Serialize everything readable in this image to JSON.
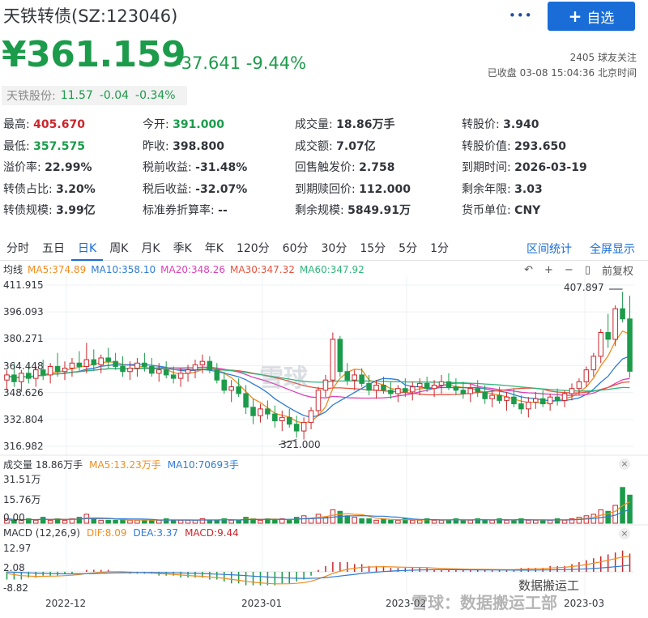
{
  "header": {
    "title": "天铁转债(SZ:123046)",
    "more": "•••",
    "add_button_plus": "+",
    "add_button": "自选",
    "price": "¥361.159",
    "change": "-37.641",
    "change_pct": "-9.44%",
    "follow": "2405 球友关注",
    "status": "已收盘 03-08 15:04:36 北京时间"
  },
  "stock_tag": {
    "label": "天铁股份:",
    "price": "11.57",
    "change": "-0.04",
    "pct": "-0.34%"
  },
  "quote": [
    [
      {
        "k": "最高:",
        "v": "405.670",
        "c": "up"
      },
      {
        "k": "今开:",
        "v": "391.000",
        "c": "down"
      },
      {
        "k": "成交量:",
        "v": "18.86万手",
        "c": ""
      },
      {
        "k": "转股价:",
        "v": "3.940",
        "c": ""
      }
    ],
    [
      {
        "k": "最低:",
        "v": "357.575",
        "c": "down"
      },
      {
        "k": "昨收:",
        "v": "398.800",
        "c": ""
      },
      {
        "k": "成交额:",
        "v": "7.07亿",
        "c": ""
      },
      {
        "k": "转股价值:",
        "v": "293.650",
        "c": ""
      }
    ],
    [
      {
        "k": "溢价率:",
        "v": "22.99%",
        "c": ""
      },
      {
        "k": "税前收益:",
        "v": "-31.48%",
        "c": ""
      },
      {
        "k": "回售触发价:",
        "v": "2.758",
        "c": ""
      },
      {
        "k": "到期时间:",
        "v": "2026-03-19",
        "c": ""
      }
    ],
    [
      {
        "k": "转债占比:",
        "v": "3.20%",
        "c": ""
      },
      {
        "k": "税后收益:",
        "v": "-32.07%",
        "c": ""
      },
      {
        "k": "到期赎回价:",
        "v": "112.000",
        "c": ""
      },
      {
        "k": "剩余年限:",
        "v": "3.03",
        "c": ""
      }
    ],
    [
      {
        "k": "转债规模:",
        "v": "3.99亿",
        "c": ""
      },
      {
        "k": "标准券折算率:",
        "v": "--",
        "c": ""
      },
      {
        "k": "剩余规模:",
        "v": "5849.91万",
        "c": ""
      },
      {
        "k": "货币单位:",
        "v": "CNY",
        "c": ""
      }
    ]
  ],
  "tabs": [
    "分时",
    "五日",
    "日K",
    "周K",
    "月K",
    "季K",
    "年K",
    "120分",
    "60分",
    "30分",
    "15分",
    "5分",
    "1分"
  ],
  "active_tab": 2,
  "tab_links": [
    "区间统计",
    "全屏显示"
  ],
  "legend": [
    {
      "text": "均线",
      "color": "#33353c"
    },
    {
      "text": "MA5:374.89",
      "color": "#f08c1e"
    },
    {
      "text": "MA10:358.10",
      "color": "#2f7bd6"
    },
    {
      "text": "MA20:348.26",
      "color": "#d941b8"
    },
    {
      "text": "MA30:347.32",
      "color": "#e5533d"
    },
    {
      "text": "MA60:347.92",
      "color": "#2fb57a"
    }
  ],
  "kctrl": {
    "back": "↶",
    "zoom_in": "+",
    "zoom_out": "−",
    "adjust": "前复权"
  },
  "y_ticks": [
    "411.915",
    "396.093",
    "380.271",
    "364.448",
    "348.626",
    "332.804",
    "316.982"
  ],
  "marks": {
    "high": "407.897",
    "low": "321.000"
  },
  "vol_legend": [
    {
      "text": "成交量 18.86万手",
      "color": "#33353c"
    },
    {
      "text": "MA5:13.23万手",
      "color": "#f08c1e"
    },
    {
      "text": "MA10:70693手",
      "color": "#2f7bd6"
    }
  ],
  "vol_ticks": [
    "31.51万",
    "15.76万",
    "0.00"
  ],
  "macd_legend": [
    {
      "text": "MACD (12,26,9)",
      "color": "#33353c"
    },
    {
      "text": "DIF:8.09",
      "color": "#f08c1e"
    },
    {
      "text": "DEA:3.37",
      "color": "#2f7bd6"
    },
    {
      "text": "MACD:9.44",
      "color": "#c9262c"
    }
  ],
  "macd_ticks": [
    "12.97",
    "2.08",
    "-8.82"
  ],
  "close_x": "×",
  "x_ticks": [
    "2022-12",
    "2023-01",
    "2023-02",
    "2023-03"
  ],
  "watermark": "雪球",
  "watermark_bottom": "雪球：数据搬运工部",
  "wechat": "数据搬运工",
  "colors": {
    "up": "#c9262c",
    "down": "#1c9b4b",
    "accent": "#1a6dd6"
  },
  "chart_data": {
    "type": "candlestick",
    "price_axis": [
      316.982,
      411.915
    ],
    "candles": [
      [
        356,
        362,
        350,
        359
      ],
      [
        359,
        366,
        352,
        355
      ],
      [
        355,
        362,
        349,
        360
      ],
      [
        360,
        365,
        354,
        357
      ],
      [
        357,
        364,
        352,
        362
      ],
      [
        362,
        368,
        356,
        359
      ],
      [
        359,
        366,
        354,
        364
      ],
      [
        364,
        372,
        358,
        361
      ],
      [
        361,
        367,
        356,
        363
      ],
      [
        363,
        369,
        358,
        366
      ],
      [
        366,
        373,
        361,
        364
      ],
      [
        364,
        378,
        360,
        368
      ],
      [
        368,
        374,
        362,
        365
      ],
      [
        365,
        371,
        360,
        369
      ],
      [
        369,
        375,
        363,
        367
      ],
      [
        367,
        372,
        362,
        364
      ],
      [
        364,
        370,
        358,
        361
      ],
      [
        361,
        367,
        356,
        363
      ],
      [
        363,
        369,
        358,
        366
      ],
      [
        366,
        372,
        361,
        364
      ],
      [
        364,
        369,
        358,
        360
      ],
      [
        360,
        366,
        355,
        362
      ],
      [
        362,
        367,
        357,
        359
      ],
      [
        359,
        364,
        354,
        357
      ],
      [
        357,
        363,
        352,
        360
      ],
      [
        360,
        365,
        355,
        362
      ],
      [
        362,
        368,
        357,
        365
      ],
      [
        365,
        371,
        360,
        367
      ],
      [
        367,
        370,
        360,
        362
      ],
      [
        362,
        366,
        354,
        356
      ],
      [
        356,
        361,
        348,
        350
      ],
      [
        350,
        356,
        343,
        352
      ],
      [
        352,
        357,
        346,
        348
      ],
      [
        348,
        353,
        336,
        340
      ],
      [
        340,
        345,
        330,
        335
      ],
      [
        335,
        342,
        331,
        339
      ],
      [
        339,
        344,
        333,
        336
      ],
      [
        336,
        341,
        328,
        332
      ],
      [
        332,
        338,
        326,
        334
      ],
      [
        334,
        339,
        328,
        330
      ],
      [
        330,
        335,
        322,
        326
      ],
      [
        326,
        334,
        321,
        331
      ],
      [
        331,
        340,
        327,
        338
      ],
      [
        338,
        352,
        335,
        350
      ],
      [
        350,
        359,
        346,
        356
      ],
      [
        356,
        384,
        352,
        380
      ],
      [
        380,
        382,
        358,
        361
      ],
      [
        361,
        366,
        353,
        356
      ],
      [
        356,
        362,
        350,
        359
      ],
      [
        359,
        363,
        352,
        354
      ],
      [
        354,
        359,
        347,
        350
      ],
      [
        350,
        356,
        345,
        353
      ],
      [
        353,
        358,
        348,
        350
      ],
      [
        350,
        355,
        345,
        348
      ],
      [
        348,
        353,
        343,
        351
      ],
      [
        351,
        357,
        346,
        349
      ],
      [
        349,
        355,
        344,
        352
      ],
      [
        352,
        357,
        347,
        354
      ],
      [
        354,
        358,
        349,
        351
      ],
      [
        351,
        356,
        346,
        353
      ],
      [
        353,
        359,
        348,
        355
      ],
      [
        355,
        360,
        350,
        352
      ],
      [
        352,
        357,
        347,
        350
      ],
      [
        350,
        355,
        345,
        348
      ],
      [
        348,
        354,
        343,
        351
      ],
      [
        351,
        356,
        346,
        349
      ],
      [
        349,
        353,
        342,
        345
      ],
      [
        345,
        350,
        340,
        347
      ],
      [
        347,
        352,
        342,
        344
      ],
      [
        344,
        349,
        338,
        346
      ],
      [
        346,
        351,
        340,
        342
      ],
      [
        342,
        347,
        336,
        339
      ],
      [
        339,
        346,
        334,
        343
      ],
      [
        343,
        349,
        339,
        345
      ],
      [
        345,
        350,
        340,
        342
      ],
      [
        342,
        348,
        338,
        346
      ],
      [
        346,
        351,
        341,
        344
      ],
      [
        344,
        350,
        340,
        348
      ],
      [
        348,
        354,
        344,
        351
      ],
      [
        351,
        357,
        347,
        355
      ],
      [
        355,
        364,
        352,
        362
      ],
      [
        362,
        372,
        358,
        370
      ],
      [
        370,
        386,
        366,
        384
      ],
      [
        384,
        395,
        375,
        380
      ],
      [
        380,
        400,
        376,
        398
      ],
      [
        398,
        408,
        390,
        392
      ],
      [
        392,
        405.67,
        357.575,
        361.159
      ]
    ],
    "volumes": [
      3,
      2,
      2,
      3,
      2,
      4,
      2,
      3,
      2,
      3,
      4,
      6,
      3,
      2,
      2,
      2,
      3,
      2,
      2,
      2,
      2,
      2,
      3,
      2,
      2,
      2,
      2,
      3,
      2,
      2,
      3,
      2,
      2,
      4,
      3,
      2,
      3,
      2,
      3,
      2,
      4,
      5,
      3,
      6,
      4,
      9,
      8,
      5,
      4,
      3,
      3,
      2,
      3,
      2,
      2,
      3,
      2,
      2,
      3,
      2,
      2,
      2,
      3,
      2,
      2,
      3,
      2,
      2,
      3,
      2,
      2,
      3,
      2,
      2,
      2,
      2,
      3,
      2,
      3,
      4,
      5,
      6,
      9,
      8,
      12,
      24,
      18.86
    ],
    "ma5_vol_last": 13.23,
    "macd_hist": [
      -4,
      -4,
      -4,
      -3,
      -3,
      -2,
      -2,
      -2,
      -1,
      -1,
      0,
      1,
      1,
      1,
      1,
      0,
      0,
      -1,
      -1,
      -1,
      -1,
      -2,
      -2,
      -2,
      -3,
      -3,
      -3,
      -3,
      -4,
      -4,
      -5,
      -6,
      -6,
      -7,
      -7,
      -7,
      -7,
      -7,
      -6,
      -6,
      -5,
      -4,
      -2,
      1,
      3,
      5,
      5,
      5,
      4,
      4,
      3,
      3,
      3,
      2,
      2,
      2,
      2,
      2,
      2,
      1,
      1,
      1,
      1,
      1,
      1,
      1,
      1,
      1,
      1,
      1,
      1,
      2,
      2,
      2,
      2,
      3,
      3,
      3,
      4,
      5,
      6,
      7,
      8,
      9,
      10,
      11,
      9.44
    ],
    "macd_range": [
      -8.82,
      12.97
    ],
    "dif_last": 8.09,
    "dea_last": 3.37
  }
}
